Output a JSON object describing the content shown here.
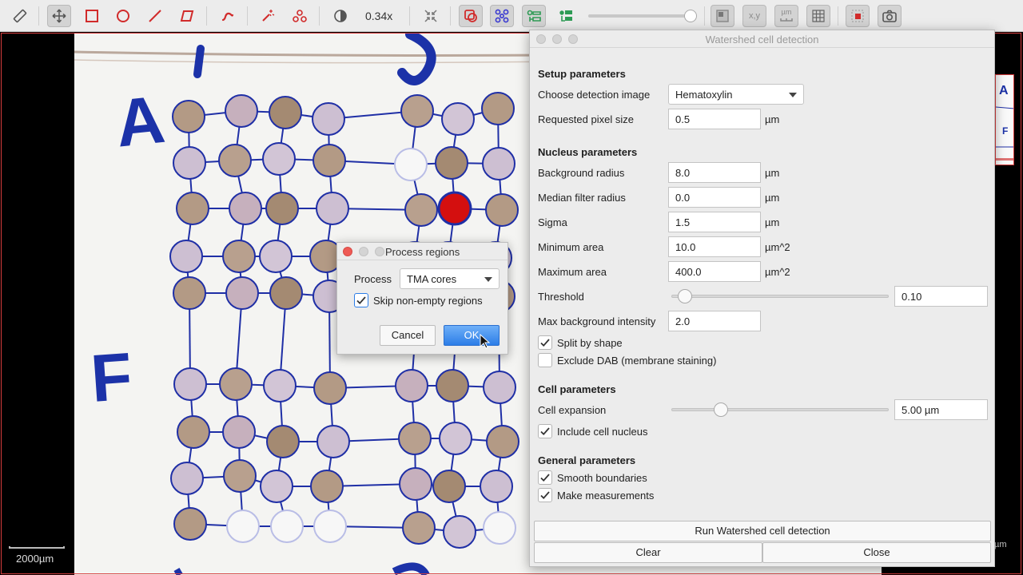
{
  "toolbar": {
    "zoom": "0.34x",
    "xy_label": "x,y",
    "um_label": "µm"
  },
  "viewer": {
    "scalebar": "2000µm",
    "edge_unit": "µm",
    "slide_labels": [
      "A",
      "F"
    ]
  },
  "watershed": {
    "title": "Watershed cell detection",
    "setup": {
      "heading": "Setup parameters",
      "detection_image_label": "Choose detection image",
      "detection_image_value": "Hematoxylin",
      "pixel_size_label": "Requested pixel size",
      "pixel_size_value": "0.5",
      "pixel_size_unit": "µm"
    },
    "nucleus": {
      "heading": "Nucleus parameters",
      "background_radius_label": "Background radius",
      "background_radius_value": "8.0",
      "background_radius_unit": "µm",
      "median_radius_label": "Median filter radius",
      "median_radius_value": "0.0",
      "median_radius_unit": "µm",
      "sigma_label": "Sigma",
      "sigma_value": "1.5",
      "sigma_unit": "µm",
      "min_area_label": "Minimum area",
      "min_area_value": "10.0",
      "min_area_unit": "µm^2",
      "max_area_label": "Maximum area",
      "max_area_value": "400.0",
      "max_area_unit": "µm^2",
      "threshold_label": "Threshold",
      "threshold_value": "0.10",
      "threshold_level": 0.03,
      "max_bg_label": "Max background intensity",
      "max_bg_value": "2.0",
      "split_shape_label": "Split by shape",
      "split_shape_checked": true,
      "exclude_dab_label": "Exclude DAB (membrane staining)",
      "exclude_dab_checked": false
    },
    "cell": {
      "heading": "Cell parameters",
      "expansion_label": "Cell expansion",
      "expansion_value": "5.00 µm",
      "expansion_level": 0.21,
      "include_nucleus_label": "Include cell nucleus",
      "include_nucleus_checked": true
    },
    "general": {
      "heading": "General parameters",
      "smooth_label": "Smooth boundaries",
      "smooth_checked": true,
      "measure_label": "Make measurements",
      "measure_checked": true
    },
    "run_button": "Run Watershed cell detection",
    "clear_button": "Clear",
    "close_button": "Close"
  },
  "process_dialog": {
    "title": "Process regions",
    "process_label": "Process",
    "process_value": "TMA cores",
    "skip_label": "Skip non-empty regions",
    "skip_checked": true,
    "cancel_button": "Cancel",
    "ok_button": "OK"
  },
  "colors": {
    "grid_blue": "#1f2fa6",
    "marker_blue": "#1c32a8",
    "selected_core": "#d40f0f",
    "dialog_accent": "#2c7de7"
  }
}
